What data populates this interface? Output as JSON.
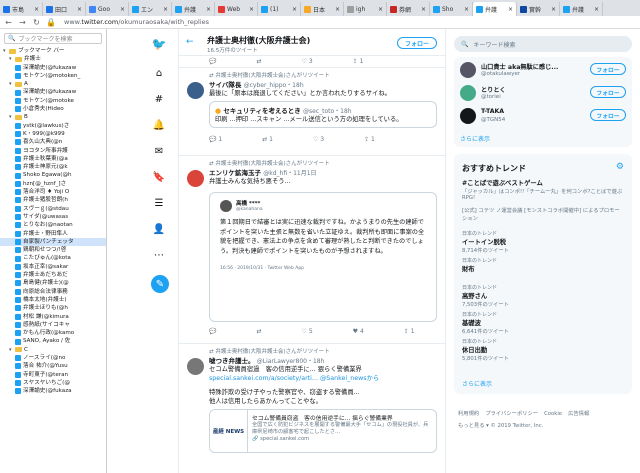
{
  "browser": {
    "tabs": [
      {
        "label": "市島",
        "color": "#1a73e8"
      },
      {
        "label": "田口",
        "color": "#1a73e8"
      },
      {
        "label": "Goo",
        "color": "#4285f4"
      },
      {
        "label": "エン",
        "color": "#1da1f2"
      },
      {
        "label": "弁護",
        "color": "#1da1f2"
      },
      {
        "label": "Web",
        "color": "#e53935"
      },
      {
        "label": "(1) ",
        "color": "#1da1f2"
      },
      {
        "label": "日本",
        "color": "#f9a825"
      },
      {
        "label": "igh",
        "color": "#9e9e9e"
      },
      {
        "label": "券網",
        "color": "#c62828"
      },
      {
        "label": "Sho",
        "color": "#1da1f2"
      },
      {
        "label": "弁護",
        "color": "#1da1f2"
      },
      {
        "label": "實幹",
        "color": "#0d47a1"
      },
      {
        "label": "弁護",
        "color": "#1da1f2"
      }
    ],
    "url_domain": "twitter.com",
    "url_path": "/okumuraosaka/with_replies",
    "url_prefix": "www."
  },
  "sidebar": {
    "search_placeholder": "ブックマークを検索",
    "items": [
      {
        "label": "ブックマーク バー",
        "type": "folder",
        "indent": 0,
        "open": true
      },
      {
        "label": "弁護士",
        "type": "folder",
        "indent": 1,
        "open": true
      },
      {
        "label": "深澤諭史(@fukazaw",
        "type": "tw",
        "indent": 2
      },
      {
        "label": "モトケン(@motoken_",
        "type": "tw",
        "indent": 2
      },
      {
        "label": "A",
        "type": "folder",
        "indent": 1,
        "open": true
      },
      {
        "label": "深澤諭史(@fukazaw",
        "type": "tw",
        "indent": 2
      },
      {
        "label": "モトケン(@motoke",
        "type": "tw",
        "indent": 2
      },
      {
        "label": "小倉秀夫(Hideo",
        "type": "tw",
        "indent": 2
      },
      {
        "label": "B",
        "type": "folder",
        "indent": 1,
        "open": true
      },
      {
        "label": "ystk(@lawkus)さ",
        "type": "tw",
        "indent": 2
      },
      {
        "label": "K・999(@k999",
        "type": "tw",
        "indent": 2
      },
      {
        "label": "喜久山大典(@n",
        "type": "tw",
        "indent": 2
      },
      {
        "label": "ヨコタン所事弁護",
        "type": "tw",
        "indent": 2
      },
      {
        "label": "弁護士秋葉東(@a",
        "type": "tw",
        "indent": 2
      },
      {
        "label": "弁護士神原元(@k",
        "type": "tw",
        "indent": 2
      },
      {
        "label": "Shoko Egawa(@h",
        "type": "tw",
        "indent": 2
      },
      {
        "label": "hzn[@_hznf_]さ",
        "type": "tw",
        "indent": 2
      },
      {
        "label": "落合洋司 ♦ Yoji O",
        "type": "tw",
        "indent": 2
      },
      {
        "label": "弁護士猪股哲朗(h",
        "type": "tw",
        "indent": 2
      },
      {
        "label": "スヴーｇ(@stdau",
        "type": "tw",
        "indent": 2
      },
      {
        "label": "サイダ(@uwasas",
        "type": "tw",
        "indent": 2
      },
      {
        "label": "とりなお(@naotan",
        "type": "tw",
        "indent": 2
      },
      {
        "label": "弁護士・野田隼人",
        "type": "tw",
        "indent": 2
      },
      {
        "label": "自家製パンチェッタ",
        "type": "tw",
        "indent": 2,
        "highlight": true
      },
      {
        "label": "鶏朝和せつつ/!啓",
        "type": "tw",
        "indent": 2
      },
      {
        "label": "こたびゅん(@kota",
        "type": "tw",
        "indent": 2
      },
      {
        "label": "坂本正幸(@sakar",
        "type": "tw",
        "indent": 2
      },
      {
        "label": "弁護士あだちあだ",
        "type": "tw",
        "indent": 2
      },
      {
        "label": "島島健(弁護士)(@",
        "type": "tw",
        "indent": 2
      },
      {
        "label": "向原総合法律事務",
        "type": "tw",
        "indent": 2
      },
      {
        "label": "橋本太地(弁護士)",
        "type": "tw",
        "indent": 2
      },
      {
        "label": "弁護士ほりも(@h",
        "type": "tw",
        "indent": 2
      },
      {
        "label": "村松 謙(@kimura",
        "type": "tw",
        "indent": 2
      },
      {
        "label": "感熱紙(サイコキャ",
        "type": "tw",
        "indent": 2
      },
      {
        "label": "かもん行政(@kamo",
        "type": "tw",
        "indent": 2
      },
      {
        "label": "SANO, Ayako / 佐",
        "type": "tw",
        "indent": 2
      },
      {
        "label": "C",
        "type": "folder",
        "indent": 1,
        "open": true
      },
      {
        "label": "ノースライ(@no",
        "type": "tw",
        "indent": 2
      },
      {
        "label": "落合 祐介(@Yusu",
        "type": "tw",
        "indent": 2
      },
      {
        "label": "寺町東子(@teran",
        "type": "tw",
        "indent": 2
      },
      {
        "label": "スヤスヤいちご(@",
        "type": "tw",
        "indent": 2
      },
      {
        "label": "深澤諭史(@fukaza",
        "type": "tw",
        "indent": 2
      }
    ]
  },
  "profile": {
    "name": "弁護士奥村徹(大阪弁護士会)",
    "tweet_count": "16.5万件のツイート",
    "follow_label": "フォロー"
  },
  "tweets": [
    {
      "type": "partial",
      "acts": [
        "",
        "",
        "3",
        "",
        "1"
      ]
    },
    {
      "type": "rt_quote",
      "rt": "弁護士奥村徹(大阪弁護士会)さんがリツイート",
      "name": "サイバ隊長",
      "handle": "@cyber_hippo・18h",
      "text": "最後に「原本は廃退してください」とか言われたりするサイね。",
      "q_name": "セキュリティを考えるとき",
      "q_handle": "@sec_toto・18h",
      "q_text": "印刷 ...押印 ...スキャン ...メール送信という方の処理をしている。",
      "acts": [
        "1",
        "1",
        "3",
        "",
        "1"
      ],
      "avatar": "#3a5f8a"
    },
    {
      "type": "rt_image",
      "rt": "弁護士奥村徹(大阪弁護士会)さんがリツイート",
      "name": "エンリケ鉱海玉子",
      "handle": "@kd_hfi・11月1日",
      "text": "弁護士みんな気持ち悪そう...",
      "img_name": "高橋 ****",
      "img_handle": "@kanahana",
      "img_text": "第１回期日で結審とは実に迅速な裁判ですね。かようまりの先生の建師でポイントを突いた主張と無数を省いた立証ゆえ。裁判所も即面に事案の全貌を把握でき、憲法上の争点を含めて審理が熟したと判断できたのでしょう。判決も建師でポイントを突いたものが予想されますね。",
      "img_foot": "16:56 · 2019/10/31 · Twitter Web App",
      "acts": [
        "",
        "",
        "5",
        "4",
        "1"
      ],
      "avatar": "#d9443b"
    },
    {
      "type": "rt_card",
      "rt": "弁護士奥村徹(大阪弁護士会)さんがリツイート",
      "name": "嘘つき弁護士。",
      "handle": "@LiarLawyer800・18h",
      "text1": "セコム警備員宿過　客の信用逆手に... 猥らく警備業界",
      "link": "special.sankei.com/a/society/arti...",
      "link_via": "@Sankei_newsから",
      "text2": "特殊詐欺の受け子やった警察官や、窃盗する警備員...",
      "text3": "他人は信用したらあかんってことやな。",
      "card_title": "セコム警備員窃盗　客の信用逆手に... 揺らぐ警備業界",
      "card_desc": "全国で広く防犯ビジネスを展開する警備最大手「セコム」の現役社員が、兵庫県尼崎市の顧客宅で起こしたとさ…",
      "card_domain": "special.sankei.com",
      "card_logo": "産経 NEWS",
      "avatar": "#777"
    }
  ],
  "right": {
    "search_placeholder": "キーワード検索",
    "recommend": [
      {
        "name": "山口貴士 aka無駄に感じ...",
        "handle": "@otakulawyer",
        "follow": "フォロー",
        "avatar": "#556"
      },
      {
        "name": "とりとく",
        "handle": "@toriei",
        "follow": "フォロー",
        "avatar": "#4a8"
      },
      {
        "name": "T-TAKA",
        "handle": "@TGN54",
        "follow": "フォロー",
        "avatar": "#14171a"
      }
    ],
    "more": "さらに表示",
    "trends_title": "おすすめトレンド",
    "trends": [
      {
        "meta": "",
        "name": "#ことばで遊ぶベストゲーム",
        "sub": "「ジャッカル」はコンポ!!「チーム一丸」を何コンボ?ことばで遊ぶRPG!"
      },
      {
        "meta": "",
        "name": "",
        "sub": "[公式] コテツ ノ運営会議 [モンストコラボ開催中] によるプロモーション"
      },
      {
        "meta": "日本のトレンド",
        "name": "イートイン脱税",
        "sub": "8,714件のツイート"
      },
      {
        "meta": "日本のトレンド",
        "name": "財布",
        "sub": ""
      },
      {
        "meta": "日本のトレンド",
        "name": "高野さん",
        "sub": "7,503件のツイート"
      },
      {
        "meta": "日本のトレンド",
        "name": "基礎波",
        "sub": "6,641件のツイート"
      },
      {
        "meta": "日本のトレンド",
        "name": "休日出勤",
        "sub": "5,801件のツイート"
      }
    ],
    "more2": "さらに表示",
    "footer1": [
      "利用規約",
      "プライバシーポリシー",
      "Cookie",
      "広告情報"
    ],
    "footer2": "もっと見る ▾   © 2019 Twitter, Inc."
  }
}
